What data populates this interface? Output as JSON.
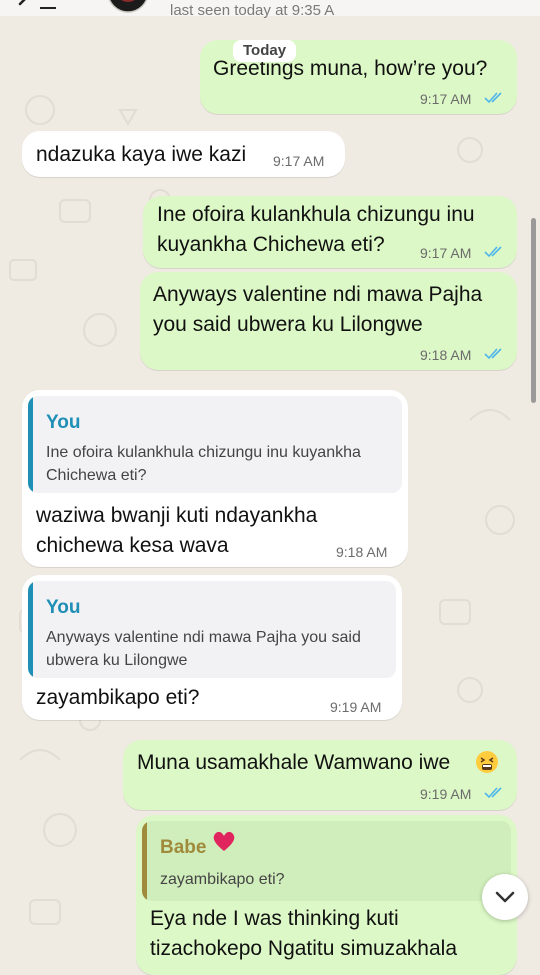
{
  "header": {
    "status": "last seen today at 9:35 A",
    "icons": [
      "back-arrow-icon",
      "avatar"
    ]
  },
  "date_chip": "Today",
  "messages": [
    {
      "direction": "out",
      "text": "Greetings muna, how’re you?",
      "time": "9:17 AM",
      "ticks": "read"
    },
    {
      "direction": "in",
      "text": "ndazuka kaya iwe kazi",
      "time": "9:17 AM"
    },
    {
      "direction": "out",
      "text": "Ine ofoira kulankhula chizungu inu\nkuyankha Chichewa eti?",
      "time": "9:17 AM",
      "ticks": "read"
    },
    {
      "direction": "out",
      "text": "Anyways valentine ndi mawa Pajha\nyou said ubwera ku Lilongwe",
      "time": "9:18 AM",
      "ticks": "read"
    },
    {
      "direction": "in",
      "quote": {
        "author": "You",
        "text": "Ine ofoira kulankhula chizungu inu kuyankha\nChichewa eti?"
      },
      "text": "waziwa bwanji kuti ndayankha\nchichewa kesa wava",
      "time": "9:18 AM"
    },
    {
      "direction": "in",
      "quote": {
        "author": "You",
        "text": "Anyways valentine ndi mawa Pajha you said\nubwera ku Lilongwe"
      },
      "text": "zayambikapo eti?",
      "time": "9:19 AM"
    },
    {
      "direction": "out",
      "text": "Muna usamakhale Wamwano iwe",
      "emoji": "tired-face-emoji",
      "time": "9:19 AM",
      "ticks": "read"
    },
    {
      "direction": "out",
      "quote": {
        "author": "Babe",
        "emoji": "heart-emoji",
        "text": "zayambikapo eti?"
      },
      "text": "Eya nde I was thinking kuti\ntizachokepo Ngatitu simuzakhala"
    }
  ],
  "colors": {
    "background": "#efeae2",
    "outgoing": "#dcf8c6",
    "incoming": "#ffffff",
    "read_ticks": "#4fb6ec",
    "quote_you": "#1f8fb5",
    "quote_babe": "#a08a3c",
    "heart": "#e0245e"
  },
  "scroll_button_icon": "chevron-down-icon"
}
